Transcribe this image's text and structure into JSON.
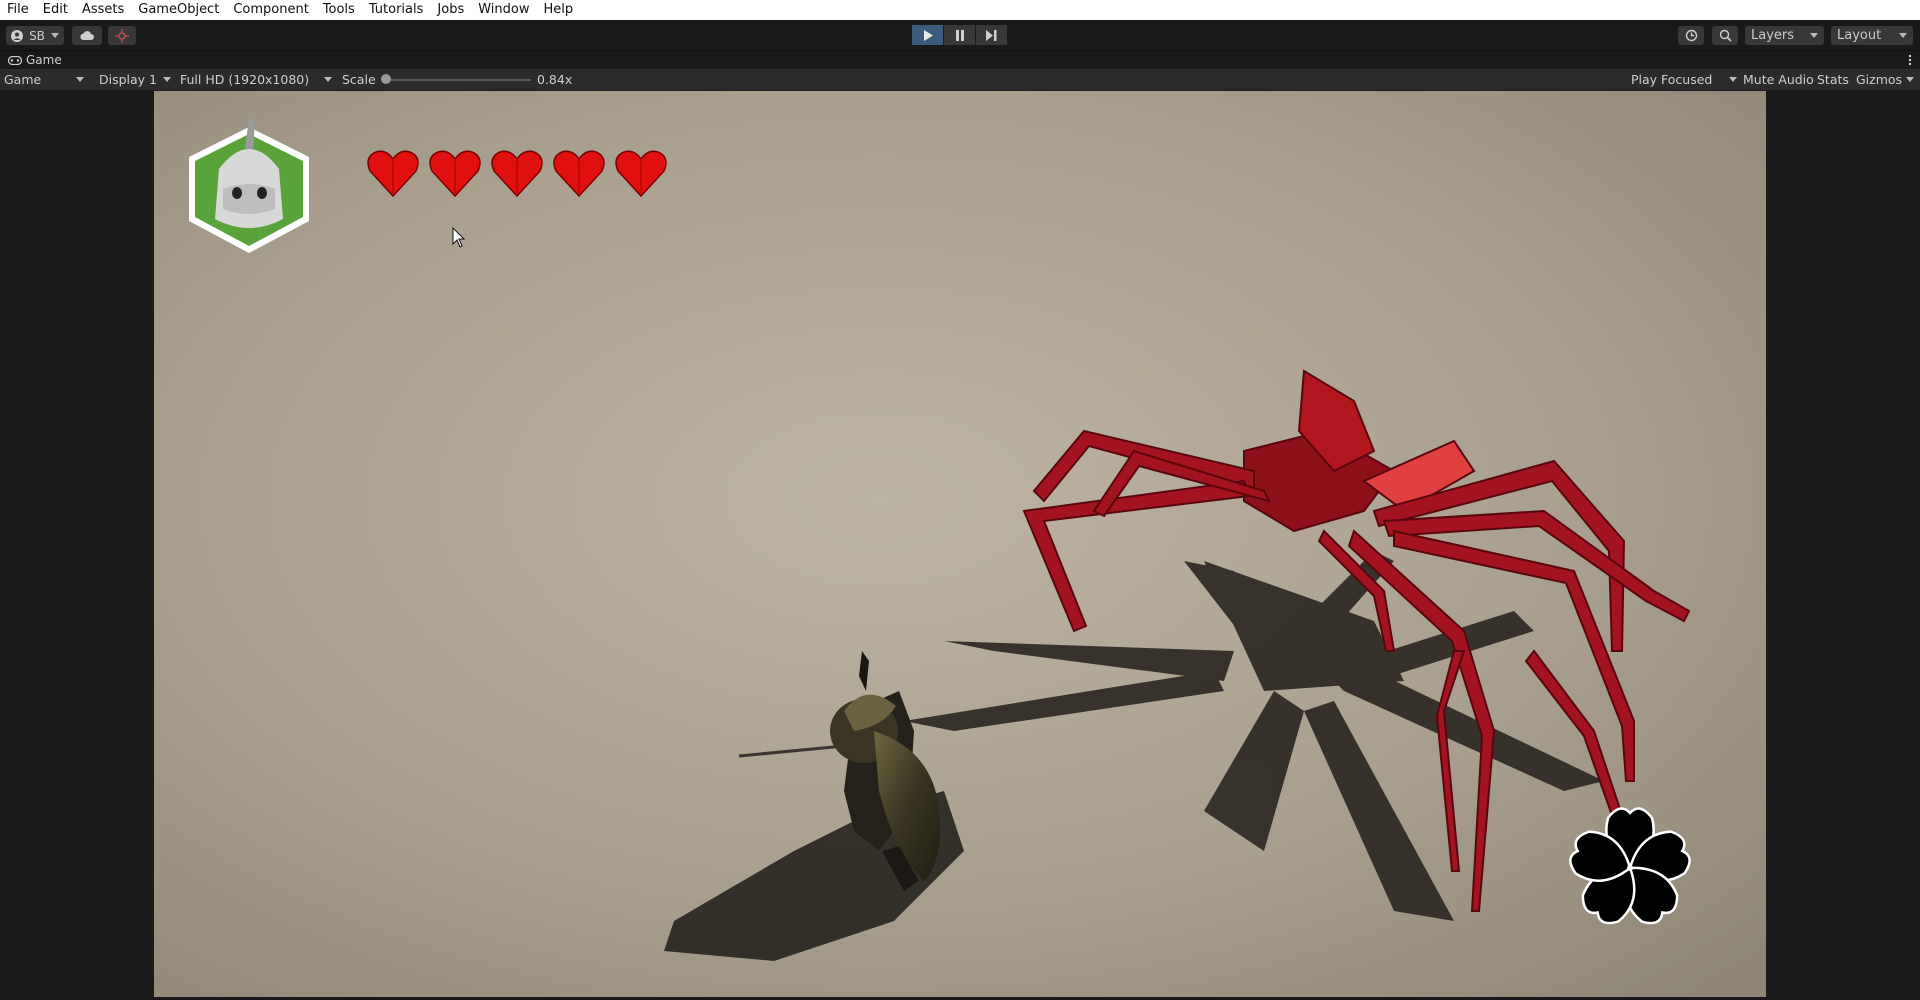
{
  "menu": [
    "File",
    "Edit",
    "Assets",
    "GameObject",
    "Component",
    "Tools",
    "Tutorials",
    "Jobs",
    "Window",
    "Help"
  ],
  "toolbar": {
    "account_label": "SB",
    "cloud_icon": "cloud-icon",
    "collab_icon": "collab-icon",
    "play_icon": "play-icon",
    "pause_icon": "pause-icon",
    "step_icon": "step-icon",
    "history_icon": "history-icon",
    "search_icon": "search-icon",
    "layers_label": "Layers",
    "layout_label": "Layout",
    "play_active_color": "#3a5b7e"
  },
  "tab": {
    "title": "Game",
    "icon": "gamepad-icon",
    "more_icon": "kebab-menu-icon"
  },
  "gamebar": {
    "mode": "Game",
    "display": "Display 1",
    "resolution": "Full HD (1920x1080)",
    "scale_label": "Scale",
    "scale_value": "0.84x",
    "scale_fraction": 0.0,
    "play_focused": "Play Focused",
    "mute_audio": "Mute Audio",
    "stats": "Stats",
    "gizmos": "Gizmos"
  },
  "game": {
    "character_badge_icon": "character-portrait-icon",
    "hearts": 5,
    "heart_color": "#e01010",
    "badge_color": "#5aa33a",
    "spider_color": "#a31420",
    "emblem_icon": "sakura-emblem-icon"
  }
}
